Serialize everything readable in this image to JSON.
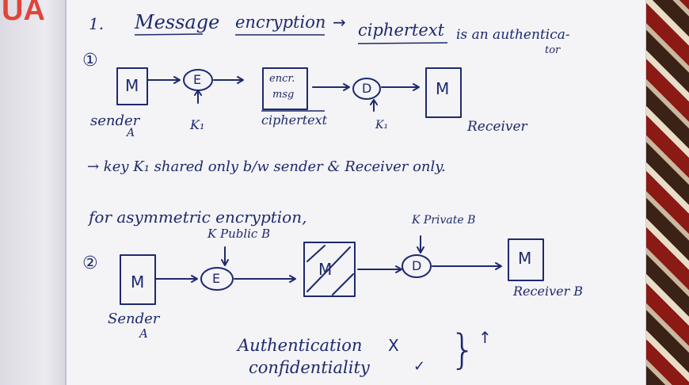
{
  "corner_mark": "UA",
  "section1": {
    "number": "1.",
    "heading_part1": "Message",
    "heading_part2": "encryption",
    "arrow": "→",
    "heading_part3": "ciphertext",
    "heading_tail": "is an authentica-",
    "heading_tail2": "tor",
    "diagram_number": "①",
    "box_sender_msg": "M",
    "node_encrypt": "E",
    "box_encr_msg_line1": "encr.",
    "box_encr_msg_line2": "msg",
    "node_decrypt": "D",
    "box_receiver_msg": "M",
    "key_label_encrypt": "K₁",
    "key_label_decrypt": "K₁",
    "sender_label": "sender",
    "sender_sub": "A",
    "ciphertext_label": "ciphertext",
    "receiver_label": "Receiver",
    "note": "→ key  K₁ shared only b/w sender & Receiver only."
  },
  "section2": {
    "intro": "for asymmetric encryption,",
    "diagram_number": "②",
    "key_public": "K Public B",
    "key_private": "K Private B",
    "box_sender_msg": "M",
    "node_encrypt": "E",
    "box_cipher_msg": "M",
    "node_decrypt": "D",
    "box_receiver_msg": "M",
    "sender_label": "Sender",
    "sender_sub": "A",
    "receiver_label": "Receiver B",
    "authentication": "Authentication",
    "authentication_mark": "X",
    "confidentiality": "confidentiality",
    "confidentiality_mark": "✓",
    "brace": "}",
    "brace_mark": "↑"
  }
}
